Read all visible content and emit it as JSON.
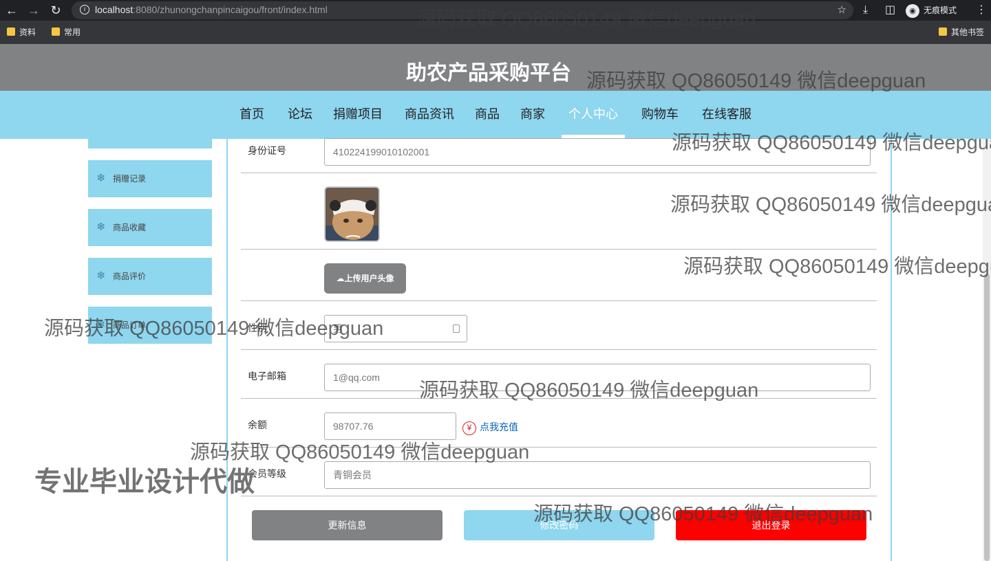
{
  "browser": {
    "url_host": "localhost",
    "url_path": ":8080/zhunongchanpincaigou/front/index.html",
    "incognito_label": "无痕模式",
    "bookmarks": [
      "资料",
      "常用"
    ],
    "other_bookmarks": "其他书签"
  },
  "site": {
    "title": "助农产品采购平台",
    "nav": [
      "首页",
      "论坛",
      "捐赠项目",
      "商品资讯",
      "商品",
      "商家",
      "个人中心",
      "购物车",
      "在线客服"
    ],
    "active_nav": "个人中心"
  },
  "sidebar": {
    "items": [
      {
        "label": "捐赠记录",
        "icon": "snowflake-icon"
      },
      {
        "label": "商品收藏",
        "icon": "snowflake-icon"
      },
      {
        "label": "商品评价",
        "icon": "snowflake-icon"
      },
      {
        "label": "商品订单",
        "icon": "snowflake-icon"
      }
    ]
  },
  "form": {
    "id_label": "身份证号",
    "id_value": "410224199010102001",
    "upload_label": "上传用户头像",
    "gender_label": "性别",
    "gender_value": "男",
    "email_label": "电子邮箱",
    "email_value": "1@qq.com",
    "balance_label": "余额",
    "balance_value": "98707.76",
    "recharge_label": "点我充值",
    "level_label": "会员等级",
    "level_value": "青铜会员"
  },
  "actions": {
    "update": "更新信息",
    "change_password": "修改密码",
    "logout": "退出登录"
  },
  "colors": {
    "nav_bg": "#8fd6ef",
    "header_bg": "#808284",
    "logout_bg": "#ff0000"
  },
  "watermarks": {
    "contact": "源码获取 QQ86050149 微信deepguan",
    "slogan": "专业毕业设计代做"
  }
}
